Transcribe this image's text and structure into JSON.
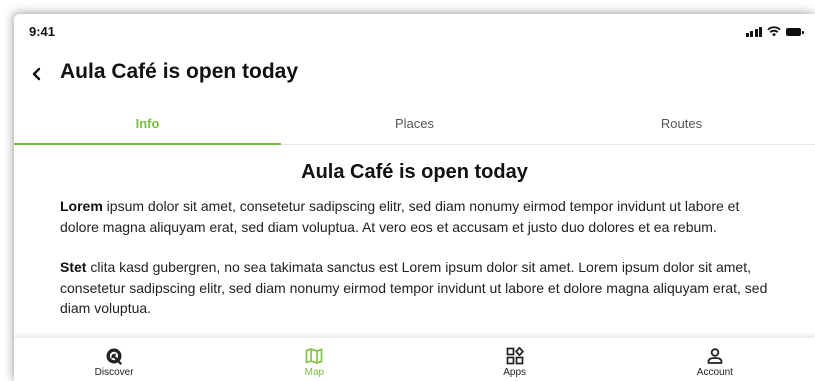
{
  "status_bar": {
    "time": "9:41"
  },
  "header": {
    "back_icon": "chevron-left-icon",
    "title": "Aula Café is open today"
  },
  "tabs": [
    {
      "label": "Info",
      "active": true
    },
    {
      "label": "Places",
      "active": false
    },
    {
      "label": "Routes",
      "active": false
    }
  ],
  "article": {
    "title": "Aula Café is open today",
    "paragraphs": [
      {
        "lead": "Lorem",
        "text": " ipsum dolor sit amet, consetetur sadipscing elitr, sed diam nonumy eirmod tempor invidunt ut labore et dolore magna aliquyam erat, sed diam voluptua. At vero eos et accusam et justo duo dolores et ea rebum."
      },
      {
        "lead": "Stet",
        "text": " clita kasd gubergren, no sea takimata sanctus est Lorem ipsum dolor sit amet. Lorem ipsum dolor sit amet, consetetur sadipscing elitr, sed diam nonumy eirmod tempor invidunt ut labore et dolore magna aliquyam erat, sed diam voluptua."
      }
    ]
  },
  "bottom_nav": [
    {
      "label": "Discover",
      "icon": "discover-icon",
      "active": false
    },
    {
      "label": "Map",
      "icon": "map-icon",
      "active": true
    },
    {
      "label": "Apps",
      "icon": "apps-icon",
      "active": false
    },
    {
      "label": "Account",
      "icon": "account-icon",
      "active": false
    }
  ],
  "colors": {
    "accent": "#7bbf3e",
    "text": "#111111",
    "muted": "#555555"
  }
}
